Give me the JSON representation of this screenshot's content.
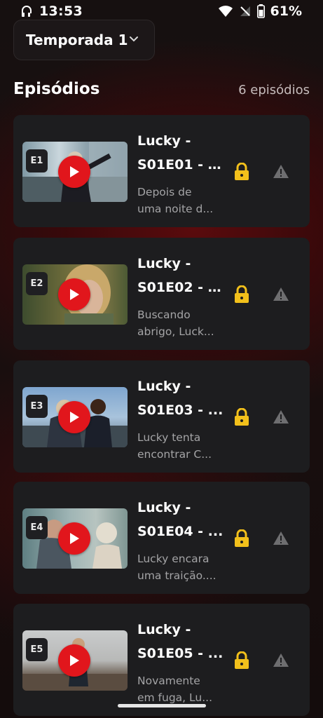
{
  "status": {
    "time": "13:53",
    "battery": "61%"
  },
  "season": {
    "label": "Temporada 1"
  },
  "episodes_header": {
    "title": "Episódios",
    "count": "6 episódios"
  },
  "episodes": [
    {
      "badge": "E1",
      "title_line1": "Lucky -",
      "title_line2": "S01E01 - S...",
      "desc_line1": "Depois de",
      "desc_line2": "uma noite d..."
    },
    {
      "badge": "E2",
      "title_line1": "Lucky -",
      "title_line2": "S01E02 - F...",
      "desc_line1": "Buscando",
      "desc_line2": "abrigo, Luck..."
    },
    {
      "badge": "E3",
      "title_line1": "Lucky -",
      "title_line2": "S01E03 - ...",
      "desc_line1": "Lucky tenta",
      "desc_line2": "encontrar C..."
    },
    {
      "badge": "E4",
      "title_line1": "Lucky -",
      "title_line2": "S01E04 - ...",
      "desc_line1": "Lucky encara",
      "desc_line2": "uma traição...."
    },
    {
      "badge": "E5",
      "title_line1": "Lucky -",
      "title_line2": "S01E05 - ...",
      "desc_line1": "Novamente",
      "desc_line2": "em fuga, Lu..."
    }
  ],
  "icons": {
    "lock": "lock-icon",
    "warning": "warning-icon",
    "play": "play-icon"
  },
  "colors": {
    "lock": "#f2c01b",
    "play": "#e1161c",
    "card": "#1d1d1f",
    "warning": "#6e6e70"
  }
}
